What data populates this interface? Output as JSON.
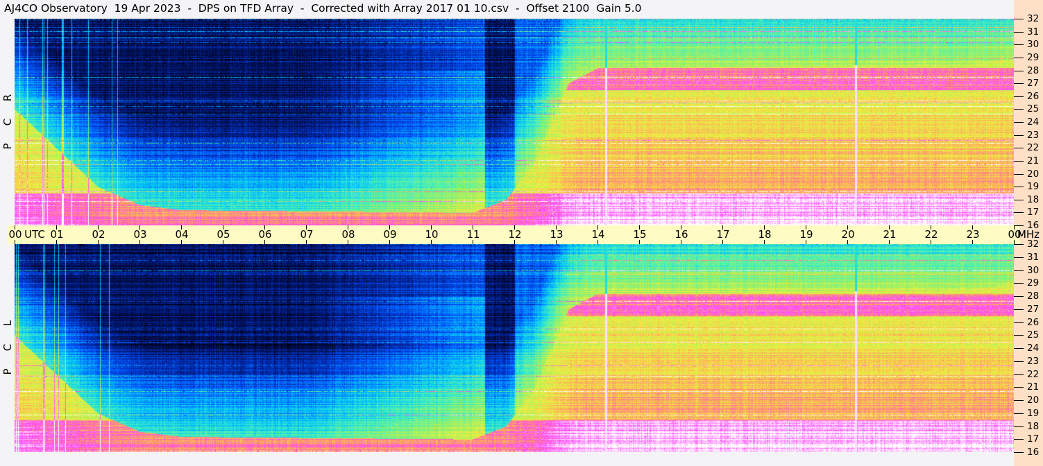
{
  "title": "AJ4CO Observatory  19 Apr 2023  -  DPS on TFD Array  -  Corrected with Array 2017 01 10.csv  -  Offset 2100  Gain 5.0",
  "chart_data": {
    "type": "heatmap",
    "title": "AJ4CO Observatory  19 Apr 2023  -  DPS on TFD Array  -  Corrected with Array 2017 01 10.csv  -  Offset 2100  Gain 5.0",
    "x_unit": "UTC",
    "y_unit": "MHz",
    "xlim": [
      0,
      24
    ],
    "ylim": [
      16,
      32
    ],
    "x_ticks": [
      "00",
      "01",
      "02",
      "03",
      "04",
      "05",
      "06",
      "07",
      "08",
      "09",
      "10",
      "11",
      "12",
      "13",
      "14",
      "15",
      "16",
      "17",
      "18",
      "19",
      "20",
      "21",
      "22",
      "23",
      "00"
    ],
    "y_ticks": [
      "32",
      "31",
      "30",
      "29",
      "28",
      "27",
      "26",
      "25",
      "24",
      "23",
      "22",
      "21",
      "20",
      "19",
      "18",
      "17",
      "16"
    ],
    "panels": [
      {
        "label": [
          "R",
          "C",
          "P"
        ]
      },
      {
        "label": [
          "L",
          "C",
          "P"
        ]
      }
    ],
    "colormap": [
      "#000010",
      "#001a80",
      "#0050ff",
      "#00c0ff",
      "#40f0c0",
      "#a0f060",
      "#f0f040",
      "#ffa060",
      "#ff40ff",
      "#ffffff"
    ],
    "vertical_markers_utc": [
      14.2,
      20.2
    ]
  }
}
